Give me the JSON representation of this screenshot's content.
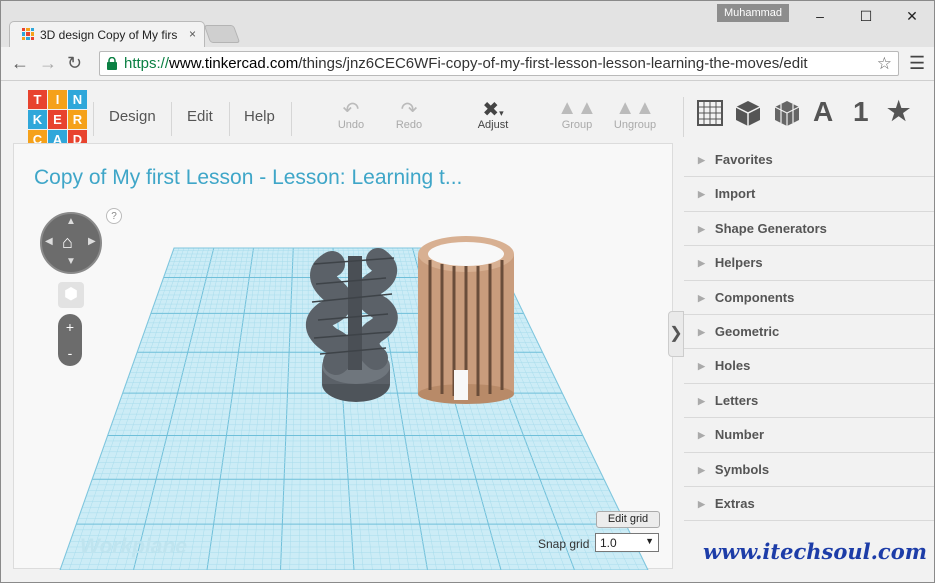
{
  "browser": {
    "tab_title": "3D design Copy of My firs",
    "tab_close": "×",
    "profile_name": "Muhammad",
    "window_controls": {
      "minimize": "–",
      "maximize": "☐",
      "close": "✕"
    },
    "url_secure": "https://",
    "url_host": "www.tinkercad.com",
    "url_path": "/things/jnz6CEC6WFi-copy-of-my-first-lesson-lesson-learning-the-moves/edit",
    "nav": {
      "back": "←",
      "forward": "→",
      "reload": "↻"
    },
    "bookmark_icon": "star-outline-icon",
    "menu_icon": "hamburger-menu-icon"
  },
  "app": {
    "logo_letters": [
      "T",
      "I",
      "N",
      "K",
      "E",
      "R",
      "C",
      "A",
      "D"
    ],
    "logo_colors": [
      "#e8432e",
      "#f5a11a",
      "#2fa7da",
      "#2fa7da",
      "#e8432e",
      "#f5a11a",
      "#f5a11a",
      "#2fa7da",
      "#e8432e"
    ],
    "menu": {
      "design": "Design",
      "edit": "Edit",
      "help": "Help"
    },
    "tools": {
      "undo": "Undo",
      "redo": "Redo",
      "adjust": "Adjust",
      "group": "Group",
      "ungroup": "Ungroup"
    },
    "view_icons": [
      "grid-view-icon",
      "cube-solid-icon",
      "cube-wire-icon",
      "letter-a-icon",
      "number-1-icon",
      "star-icon"
    ],
    "view_text": {
      "letter": "A",
      "number": "1",
      "star": "★"
    }
  },
  "canvas": {
    "title": "Copy of My first Lesson - Lesson: Learning t...",
    "help": "?",
    "workplane_label": "Workplane",
    "edit_grid": "Edit grid",
    "snap_label": "Snap grid",
    "snap_value": "1.0",
    "zoom_in": "+",
    "zoom_out": "-",
    "collapse": "❯"
  },
  "sidebar": {
    "items": [
      {
        "label": "Favorites"
      },
      {
        "label": "Import"
      },
      {
        "label": "Shape Generators"
      },
      {
        "label": "Helpers"
      },
      {
        "label": "Components"
      },
      {
        "label": "Geometric"
      },
      {
        "label": "Holes"
      },
      {
        "label": "Letters"
      },
      {
        "label": "Number"
      },
      {
        "label": "Symbols"
      },
      {
        "label": "Extras"
      }
    ]
  },
  "watermark": "www.itechsoul.com",
  "colors": {
    "accent": "#3fa6c8",
    "grid": "#9ed9ec",
    "shape_dark": "#555b62",
    "shape_wood": "#c99c7c"
  }
}
